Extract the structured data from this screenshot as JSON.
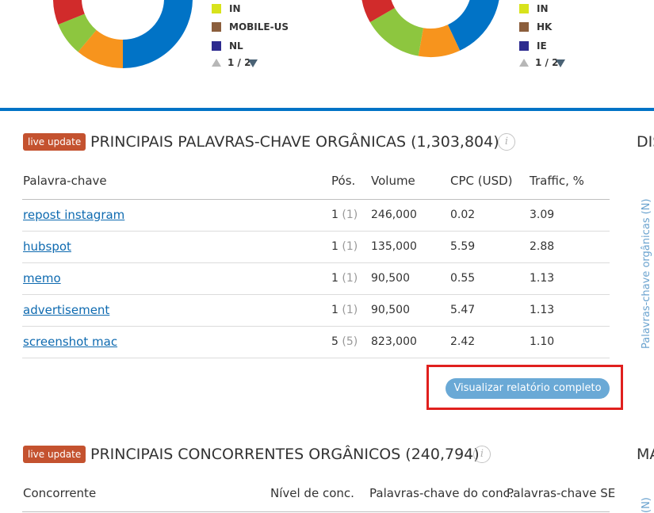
{
  "charts_top": {
    "left_legend": {
      "items": [
        {
          "label": "IN",
          "color": "#d8e31c"
        },
        {
          "label": "MOBILE-US",
          "color": "#8b5e3c"
        },
        {
          "label": "NL",
          "color": "#2d2b8f"
        }
      ],
      "pager": "1 / 2"
    },
    "right_legend": {
      "items": [
        {
          "label": "IN",
          "color": "#d8e31c"
        },
        {
          "label": "HK",
          "color": "#8b5e3c"
        },
        {
          "label": "IE",
          "color": "#2d2b8f"
        }
      ],
      "pager": "1 / 2"
    },
    "donut_colors": [
      "#0173c6",
      "#f7941d",
      "#8dc63f",
      "#d12b2b",
      "#d8e31c"
    ]
  },
  "keywords_section": {
    "badge": "live update",
    "title": "PRINCIPAIS PALAVRAS-CHAVE ORGÂNICAS (1,303,804)",
    "side_title": "DIS",
    "columns": [
      "Palavra-chave",
      "Pós.",
      "Volume",
      "CPC (USD)",
      "Traffic, %"
    ],
    "rows": [
      {
        "keyword": "repost instagram",
        "pos": "1",
        "prev": "(1)",
        "volume": "246,000",
        "cpc": "0.02",
        "traffic": "3.09"
      },
      {
        "keyword": "hubspot",
        "pos": "1",
        "prev": "(1)",
        "volume": "135,000",
        "cpc": "5.59",
        "traffic": "2.88"
      },
      {
        "keyword": "memo",
        "pos": "1",
        "prev": "(1)",
        "volume": "90,500",
        "cpc": "0.55",
        "traffic": "1.13"
      },
      {
        "keyword": "advertisement",
        "pos": "1",
        "prev": "(1)",
        "volume": "90,500",
        "cpc": "5.47",
        "traffic": "1.13"
      },
      {
        "keyword": "screenshot mac",
        "pos": "5",
        "prev": "(5)",
        "volume": "823,000",
        "cpc": "2.42",
        "traffic": "1.10"
      }
    ],
    "button": "Visualizar relatório completo",
    "vertical_label": "Palavras-chave orgânicas (N)"
  },
  "competitors_section": {
    "badge": "live update",
    "title": "PRINCIPAIS CONCORRENTES ORGÂNICOS (240,794)",
    "side_title": "MA",
    "columns": [
      "Concorrente",
      "Nível de conc.",
      "Palavras-chave do conc.",
      "Palavras-chave SE"
    ],
    "vertical_label": "(N)"
  },
  "info_icon_glyph": "i"
}
